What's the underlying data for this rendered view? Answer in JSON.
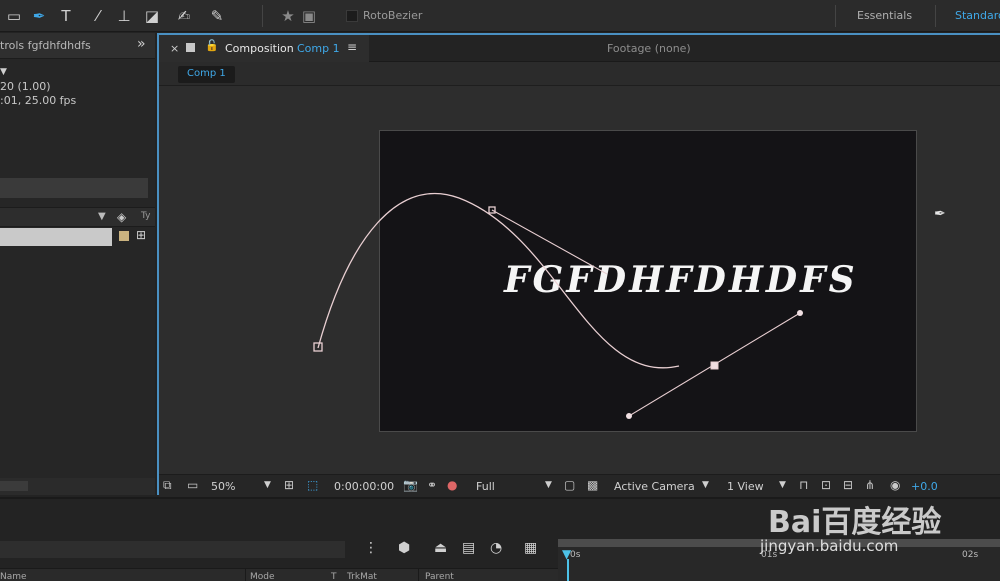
{
  "toolbar": {
    "roto_label": "RotoBezier",
    "workspaces": {
      "essentials": "Essentials",
      "standard": "Standard"
    },
    "tools": [
      "rectangle-tool",
      "pen-tool",
      "type-tool",
      "brush-tool",
      "clone-stamp-tool",
      "eraser-tool",
      "roto-brush-tool",
      "puppet-pin-tool",
      "star-icon",
      "anchor-icon"
    ]
  },
  "left_panel": {
    "title": "trols fgfdhfdhdfs",
    "pixel_ratio": "20 (1.00)",
    "duration": ":01, 25.00 fps",
    "col_type": "Ty"
  },
  "comp_panel": {
    "tab_label": "Composition",
    "comp_name": "Comp 1",
    "footage_tab": "Footage (none)",
    "flowchart_crumb": "Comp 1",
    "canvas_text": "FGFDHFDHDFS"
  },
  "viewer_bar": {
    "zoom": "50%",
    "timecode": "0:00:00:00",
    "resolution": "Full",
    "camera": "Active Camera",
    "views": "1 View",
    "exposure": "+0.0"
  },
  "timeline": {
    "columns": {
      "name": "Name",
      "mode": "Mode",
      "t": "T",
      "trkmat": "TrkMat",
      "parent": "Parent"
    },
    "ticks": [
      "0s",
      "01s",
      "02s"
    ]
  },
  "watermark": {
    "logo": "Bai百度经验",
    "url": "jingyan.baidu.com"
  },
  "colors": {
    "accent": "#3fa8e8",
    "panel_border": "#4a90c2",
    "canvas_bg": "#141316",
    "path_stroke": "#e9cfd2"
  }
}
